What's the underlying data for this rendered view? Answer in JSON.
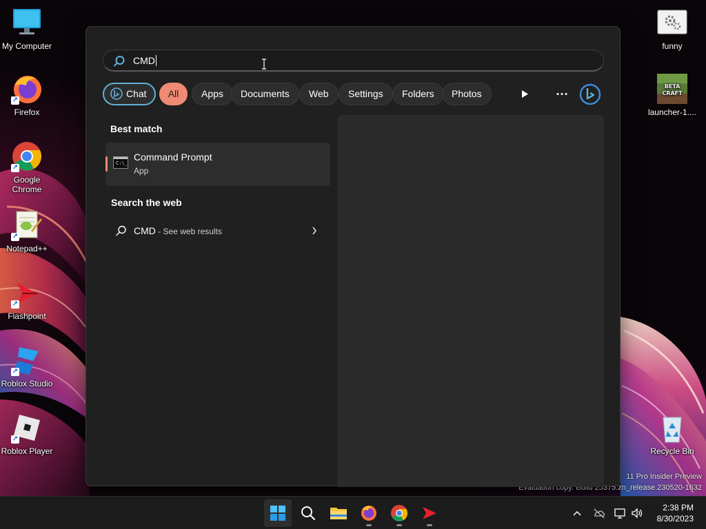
{
  "desktop": {
    "icons_left": [
      {
        "label": "My Computer"
      },
      {
        "label": "Firefox"
      },
      {
        "label": "Google Chrome"
      },
      {
        "label": "Notepad++"
      },
      {
        "label": "Flashpoint"
      },
      {
        "label": "Roblox Studio"
      },
      {
        "label": "Roblox Player"
      }
    ],
    "icons_right": [
      {
        "label": "funny"
      },
      {
        "label": "launcher-1...."
      },
      {
        "label": "Recycle Bin"
      }
    ],
    "beta_craft_text": "BETA CRAFT",
    "watermark_line1": "11 Pro Insider Preview",
    "watermark_line2": "Evaluation copy. Build 25375.zn_release.230520-1632"
  },
  "search": {
    "query": "CMD",
    "filters": [
      {
        "label": "Chat",
        "active": false
      },
      {
        "label": "All",
        "active": true
      },
      {
        "label": "Apps",
        "active": false
      },
      {
        "label": "Documents",
        "active": false
      },
      {
        "label": "Web",
        "active": false
      },
      {
        "label": "Settings",
        "active": false
      },
      {
        "label": "Folders",
        "active": false
      },
      {
        "label": "Photos",
        "active": false
      }
    ],
    "best_match_heading": "Best match",
    "best_match": {
      "title": "Command Prompt",
      "subtitle": "App"
    },
    "web_heading": "Search the web",
    "web_result": {
      "query": "CMD",
      "suffix": " - See web results"
    }
  },
  "taskbar": {
    "apps": [
      "start-icon",
      "search-icon",
      "file-explorer-icon",
      "firefox-icon",
      "chrome-icon",
      "flashpoint-icon"
    ],
    "time": "2:38 PM",
    "date": "8/30/2023"
  },
  "colors": {
    "accent_pill": "#f08a74",
    "chat_border": "#5fb2dc",
    "flyout_bg": "#202020",
    "taskbar_bg": "#1c1c1c"
  }
}
